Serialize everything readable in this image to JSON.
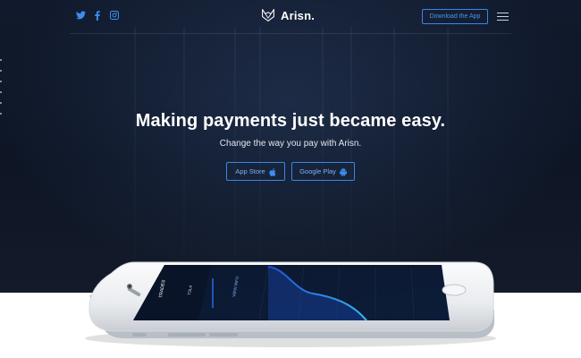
{
  "brand": {
    "name": "Arisn.",
    "logo_icon": "fox-logo-icon"
  },
  "header": {
    "social": [
      {
        "name": "twitter",
        "icon": "twitter-icon"
      },
      {
        "name": "facebook",
        "icon": "facebook-icon"
      },
      {
        "name": "instagram",
        "icon": "instagram-icon"
      }
    ],
    "download_label": "Download the App",
    "menu_icon": "hamburger-menu-icon"
  },
  "hero": {
    "headline": "Making payments just became easy.",
    "subline": "Change the way you pay with Arisn.",
    "buttons": {
      "app_store_label": "App Store",
      "app_store_icon": "apple-icon",
      "google_play_label": "Google Play",
      "google_play_icon": "android-icon"
    }
  },
  "phone_screen": {
    "tabs": [
      "TRADES",
      "TSLA",
      "VIEW INFO"
    ]
  },
  "colors": {
    "accent": "#3b86e6",
    "hero_bg": "#111a2c",
    "page_bg": "#ffffff"
  }
}
